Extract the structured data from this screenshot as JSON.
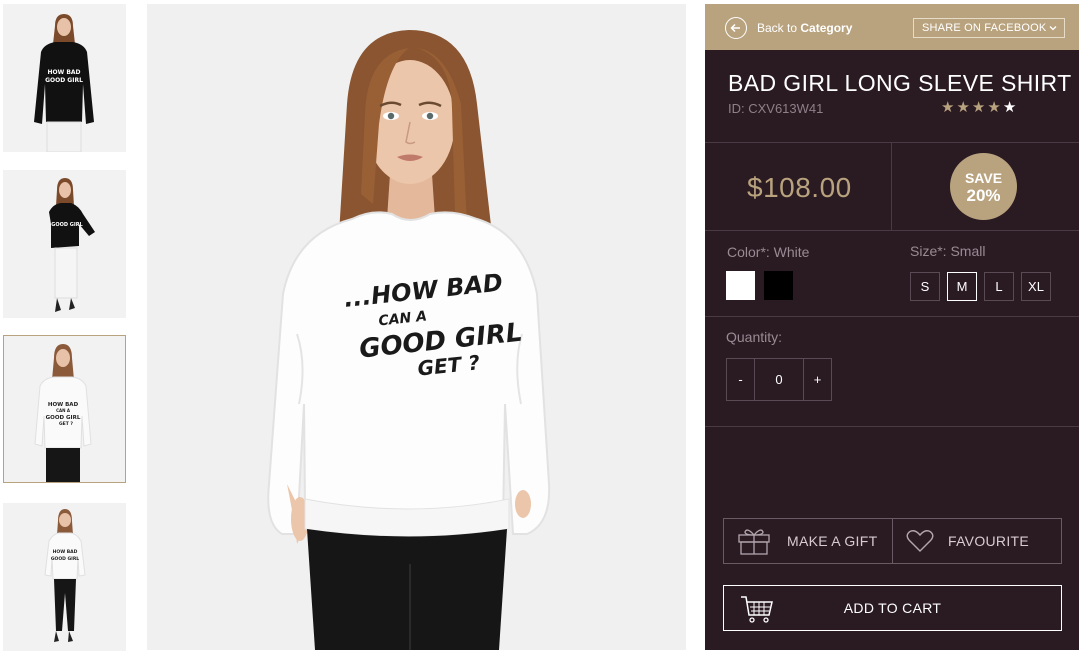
{
  "gallery": {
    "thumbnails": [
      {
        "alt": "black shirt front",
        "shirt_color": "#111111",
        "pants_color": "#f2f2f2",
        "selected": false
      },
      {
        "alt": "black shirt side",
        "shirt_color": "#111111",
        "pants_color": "#f2f2f2",
        "selected": false
      },
      {
        "alt": "white shirt front",
        "shirt_color": "#f8f8f8",
        "pants_color": "#161616",
        "selected": true
      },
      {
        "alt": "white shirt full",
        "shirt_color": "#f8f8f8",
        "pants_color": "#161616",
        "selected": false
      }
    ],
    "print_text": [
      "...HOW BAD",
      "CAN A",
      "GOOD GIRL",
      "GET ?"
    ]
  },
  "topbar": {
    "back_prefix": "Back to ",
    "back_bold": "Category",
    "share_label": "SHARE ON FACEBOOK"
  },
  "product": {
    "title": "BAD GIRL LONG SLEVE SHIRT",
    "id_text": "ID: CXV613W41",
    "rating": 4,
    "rating_max": 5,
    "price": "$108.00",
    "save_line1": "SAVE",
    "save_line2": "20%"
  },
  "color": {
    "label": "Color*: White",
    "options": [
      {
        "name": "white",
        "hex": "#ffffff"
      },
      {
        "name": "black",
        "hex": "#000000"
      }
    ]
  },
  "size": {
    "label": "Size*: Small",
    "options": [
      "S",
      "M",
      "L",
      "XL"
    ],
    "selected": "M"
  },
  "quantity": {
    "label": "Quantity:",
    "minus": "-",
    "value": "0",
    "plus": "+"
  },
  "actions": {
    "gift_label": "MAKE A GIFT",
    "favourite_label": "FAVOURITE",
    "cart_label": "ADD TO CART"
  },
  "colors": {
    "accent": "#b9a37f",
    "panel_bg": "#2a1a22"
  }
}
